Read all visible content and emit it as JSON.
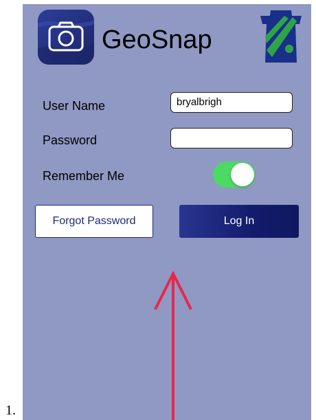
{
  "list_marker": "1.",
  "header": {
    "app_name": "GeoSnap",
    "app_icon": "camera-icon",
    "logo_icon": "keystone-logo-icon"
  },
  "login_form": {
    "username_label": "User Name",
    "username_value": "bryalbrigh",
    "password_label": "Password",
    "password_value": "",
    "remember_label": "Remember Me",
    "remember_on": true,
    "forgot_label": "Forgot Password",
    "login_label": "Log In"
  },
  "annotation": {
    "arrow_color": "#e8274b",
    "direction": "up"
  },
  "colors": {
    "background": "#8f99c3",
    "toggle_on": "#4cd964",
    "login_button": "#131c6c",
    "keystone_green": "#2ea449",
    "keystone_blue": "#1a2f8a"
  }
}
